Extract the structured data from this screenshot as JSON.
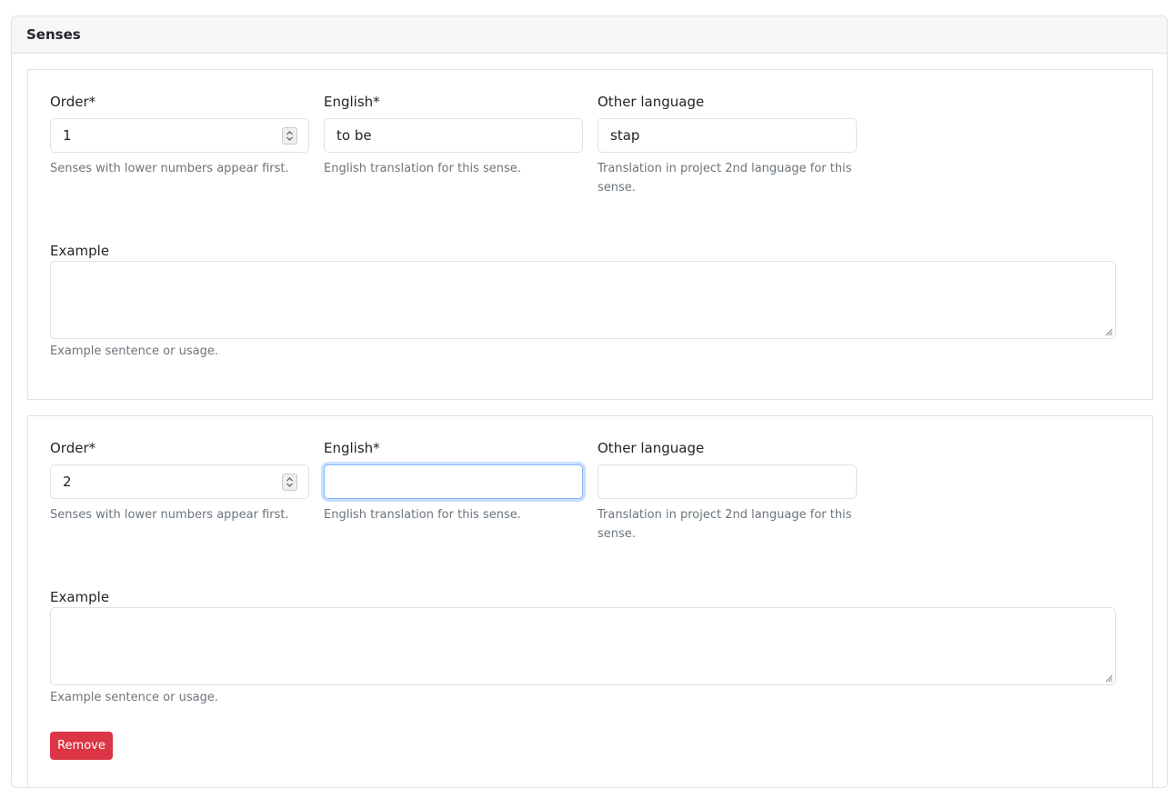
{
  "card": {
    "title": "Senses"
  },
  "senses": [
    {
      "order_label": "Order*",
      "order_value": "1",
      "order_help": "Senses with lower numbers appear first.",
      "english_label": "English*",
      "english_value": "to be",
      "english_help": "English translation for this sense.",
      "other_label": "Other language",
      "other_value": "stap",
      "other_help": "Translation in project 2nd language for this sense.",
      "example_label": "Example",
      "example_value": "",
      "example_help": "Example sentence or usage."
    },
    {
      "order_label": "Order*",
      "order_value": "2",
      "order_help": "Senses with lower numbers appear first.",
      "english_label": "English*",
      "english_value": "",
      "english_help": "English translation for this sense.",
      "other_label": "Other language",
      "other_value": "",
      "other_help": "Translation in project 2nd language for this sense.",
      "example_label": "Example",
      "example_value": "",
      "example_help": "Example sentence or usage.",
      "remove_label": "Remove"
    }
  ],
  "colors": {
    "danger": "#dc3545",
    "focus_border": "#86b7fe",
    "muted_text": "#6c757d",
    "border": "#dee2e6"
  }
}
